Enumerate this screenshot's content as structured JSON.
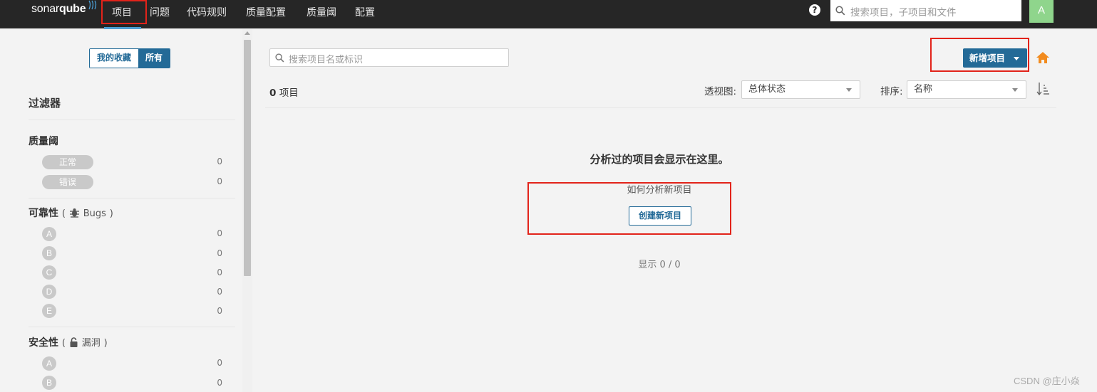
{
  "navbar": {
    "logo_light": "sonar",
    "logo_bold": "qube",
    "items": [
      "项目",
      "问题",
      "代码规则",
      "质量配置",
      "质量阈",
      "配置"
    ],
    "search_placeholder": "搜索项目，子项目和文件",
    "avatar_letter": "A"
  },
  "sidebar": {
    "toggle": {
      "favorites": "我的收藏",
      "all": "所有"
    },
    "filters_title": "过滤器",
    "quality_gate": {
      "title": "质量阈",
      "options": [
        {
          "label": "正常",
          "count": "0"
        },
        {
          "label": "错误",
          "count": "0"
        }
      ]
    },
    "reliability": {
      "title": "可靠性",
      "paren_open": "(",
      "sub": "Bugs",
      "paren_close": ")",
      "ratings": [
        {
          "label": "A",
          "count": "0"
        },
        {
          "label": "B",
          "count": "0"
        },
        {
          "label": "C",
          "count": "0"
        },
        {
          "label": "D",
          "count": "0"
        },
        {
          "label": "E",
          "count": "0"
        }
      ]
    },
    "security": {
      "title": "安全性",
      "paren_open": "(",
      "sub": "漏洞",
      "paren_close": ")",
      "ratings": [
        {
          "label": "A",
          "count": "0"
        },
        {
          "label": "B",
          "count": "0"
        }
      ]
    }
  },
  "main": {
    "search_placeholder": "搜索项目名或标识",
    "new_project_button": "新增项目",
    "project_count": "0",
    "project_count_unit": "项目",
    "perspective_label": "透视图:",
    "perspective_value": "总体状态",
    "sort_label": "排序:",
    "sort_value": "名称",
    "empty_title": "分析过的项目会显示在这里。",
    "empty_subtitle": "如何分析新项目",
    "create_button": "创建新项目",
    "paging": "显示 0 / 0"
  },
  "watermark": "CSDN @庄小焱",
  "colors": {
    "navbar": "#262626",
    "primary": "#236a97",
    "home": "#f28b1e",
    "avatar": "#8fd58c",
    "highlight": "#e2231a"
  }
}
